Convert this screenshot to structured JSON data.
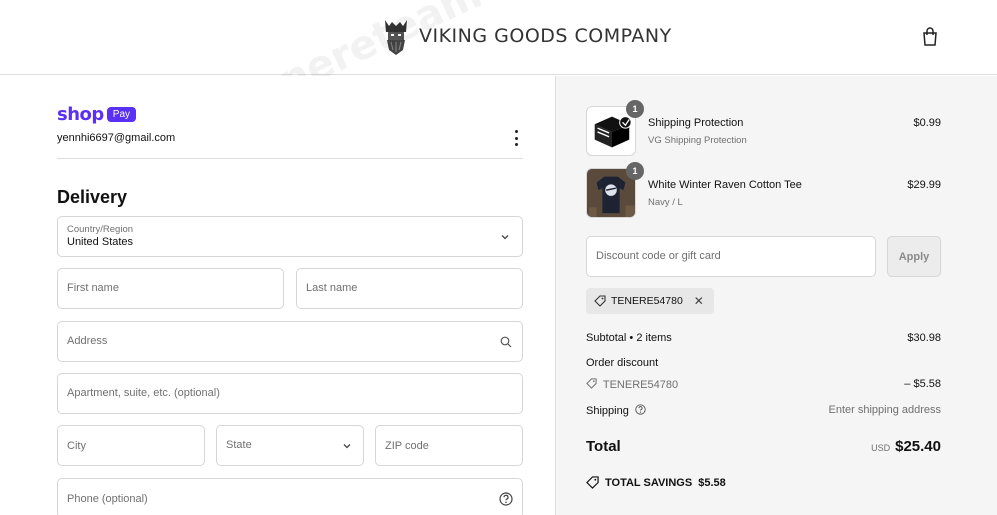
{
  "header": {
    "brand_name": "VIKING GOODS COMPANY",
    "cart_icon": "shopping-bag-icon"
  },
  "watermark": {
    "text": "Tenereteam"
  },
  "express": {
    "shop_word": "shop",
    "pay_badge": "Pay",
    "email": "yennhi6697@gmail.com"
  },
  "delivery": {
    "title": "Delivery",
    "country": {
      "label": "Country/Region",
      "value": "United States"
    },
    "first_name": {
      "placeholder": "First name"
    },
    "last_name": {
      "placeholder": "Last name"
    },
    "address": {
      "placeholder": "Address"
    },
    "apartment": {
      "placeholder": "Apartment, suite, etc. (optional)"
    },
    "city": {
      "placeholder": "City"
    },
    "state": {
      "placeholder": "State"
    },
    "zip": {
      "placeholder": "ZIP code"
    },
    "phone": {
      "placeholder": "Phone (optional)"
    }
  },
  "summary": {
    "items": [
      {
        "name": "Shipping Protection",
        "variant": "VG Shipping Protection",
        "price": "$0.99",
        "qty": "1"
      },
      {
        "name": "White Winter Raven Cotton Tee",
        "variant": "Navy / L",
        "price": "$29.99",
        "qty": "1"
      }
    ],
    "discount_placeholder": "Discount code or gift card",
    "apply_label": "Apply",
    "applied_code": "TENERE54780",
    "subtotal_label": "Subtotal • 2 items",
    "subtotal_value": "$30.98",
    "order_discount_label": "Order discount",
    "order_discount_code": "TENERE54780",
    "order_discount_value": "– $5.58",
    "shipping_label": "Shipping",
    "shipping_value": "Enter shipping address",
    "total_label": "Total",
    "currency": "USD",
    "total_value": "$25.40",
    "savings_label": "TOTAL SAVINGS",
    "savings_value": "$5.58"
  },
  "colors": {
    "shop_pay_purple": "#5a31f4",
    "summary_bg": "#f5f5f5",
    "border": "#d6d6d6"
  }
}
